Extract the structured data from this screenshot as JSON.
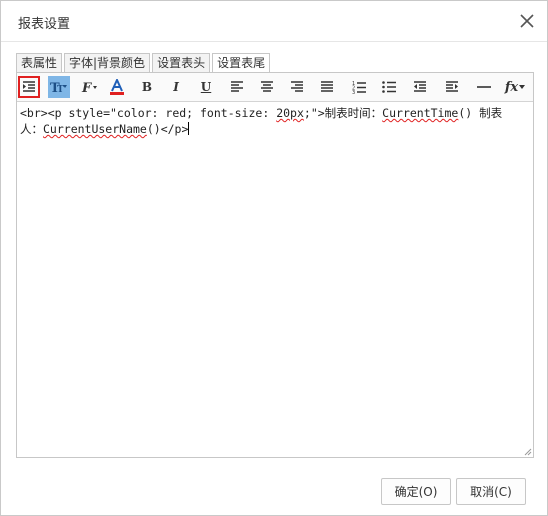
{
  "dialog": {
    "title": "报表设置",
    "close_icon": "close-icon"
  },
  "tabs": [
    {
      "label": "表属性",
      "active": false
    },
    {
      "label": "字体|背景颜色",
      "active": false
    },
    {
      "label": "设置表头",
      "active": false
    },
    {
      "label": "设置表尾",
      "active": true
    }
  ],
  "toolbar": [
    {
      "icon": "indent-icon",
      "state": "selected"
    },
    {
      "icon": "font-size-icon",
      "state": "pressed"
    },
    {
      "icon": "font-family-icon",
      "state": "normal"
    },
    {
      "icon": "font-color-icon",
      "state": "normal"
    },
    {
      "icon": "bold-icon",
      "label": "B",
      "state": "normal"
    },
    {
      "icon": "italic-icon",
      "label": "I",
      "state": "normal"
    },
    {
      "icon": "underline-icon",
      "label": "U",
      "state": "normal"
    },
    {
      "icon": "align-left-icon",
      "state": "normal"
    },
    {
      "icon": "align-center-icon",
      "state": "normal"
    },
    {
      "icon": "align-right-icon",
      "state": "normal"
    },
    {
      "icon": "align-justify-icon",
      "state": "normal"
    },
    {
      "icon": "ordered-list-icon",
      "state": "normal"
    },
    {
      "icon": "unordered-list-icon",
      "state": "normal"
    },
    {
      "icon": "outdent-icon",
      "state": "normal"
    },
    {
      "icon": "indent-right-icon",
      "state": "normal"
    },
    {
      "icon": "horizontal-rule-icon",
      "state": "normal"
    },
    {
      "icon": "function-icon",
      "label": "fx",
      "state": "normal"
    }
  ],
  "editor": {
    "part1": "<br><p style=\"color: red; font-size: ",
    "part2": "20px",
    "part3": ";\">制表时间：",
    "part4": "CurrentTime",
    "part5": "() 制表人：",
    "part6": "CurrentUserName",
    "part7": "()</p>"
  },
  "buttons": {
    "ok": "确定(O)",
    "cancel": "取消(C)"
  },
  "colors": {
    "selected_border": "#e02020",
    "pressed_bg": "#7fb6e6",
    "font_color_red": "#e02020",
    "font_color_blue": "#1f5fb8"
  }
}
